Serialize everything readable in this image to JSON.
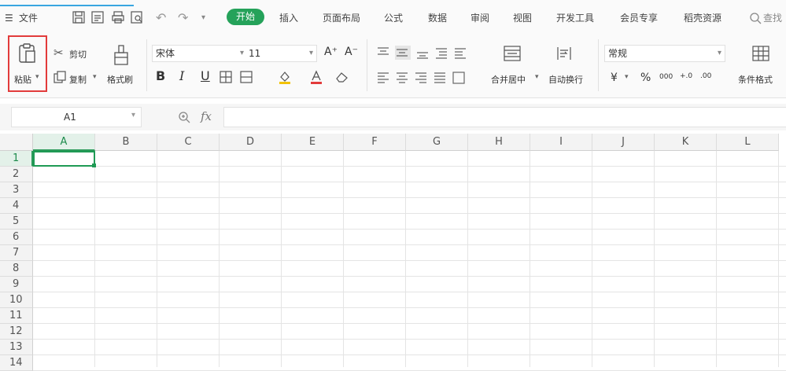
{
  "menubar": {
    "file_label": "文件",
    "undo_label": "↶",
    "redo_label": "↷",
    "more_label": "▾",
    "tabs": [
      {
        "label": "开始",
        "active": true
      },
      {
        "label": "插入"
      },
      {
        "label": "页面布局"
      },
      {
        "label": "公式"
      },
      {
        "label": "数据"
      },
      {
        "label": "审阅"
      },
      {
        "label": "视图"
      },
      {
        "label": "开发工具"
      },
      {
        "label": "会员专享"
      },
      {
        "label": "稻壳资源"
      }
    ],
    "search_label": "查找"
  },
  "ribbon": {
    "paste_label": "粘贴",
    "cut_label": "剪切",
    "copy_label": "复制",
    "format_painter_label": "格式刷",
    "font_name": "宋体",
    "font_size": "11",
    "grow_font": "A⁺",
    "shrink_font": "A⁻",
    "bold": "B",
    "italic": "I",
    "underline": "U",
    "merge_center_label": "合并居中",
    "wrap_text_label": "自动换行",
    "number_format": "常规",
    "currency_label": "¥",
    "percent_label": "%",
    "thousands_label": "000",
    "inc_decimal_label": "+.0",
    "dec_decimal_label": ".00",
    "conditional_format_label": "条件格式"
  },
  "formula_bar": {
    "cell_ref": "A1",
    "fx_label": "fx",
    "value": ""
  },
  "sheet": {
    "columns": [
      "A",
      "B",
      "C",
      "D",
      "E",
      "F",
      "G",
      "H",
      "I",
      "J",
      "K",
      "L"
    ],
    "rows": [
      "1",
      "2",
      "3",
      "4",
      "5",
      "6",
      "7",
      "8",
      "9",
      "10",
      "11",
      "12",
      "13",
      "14"
    ],
    "active_cell": "A1"
  },
  "colors": {
    "accent_green": "#25a25a",
    "highlight_red": "#e23b3b",
    "selection_green": "#1f9a55"
  }
}
